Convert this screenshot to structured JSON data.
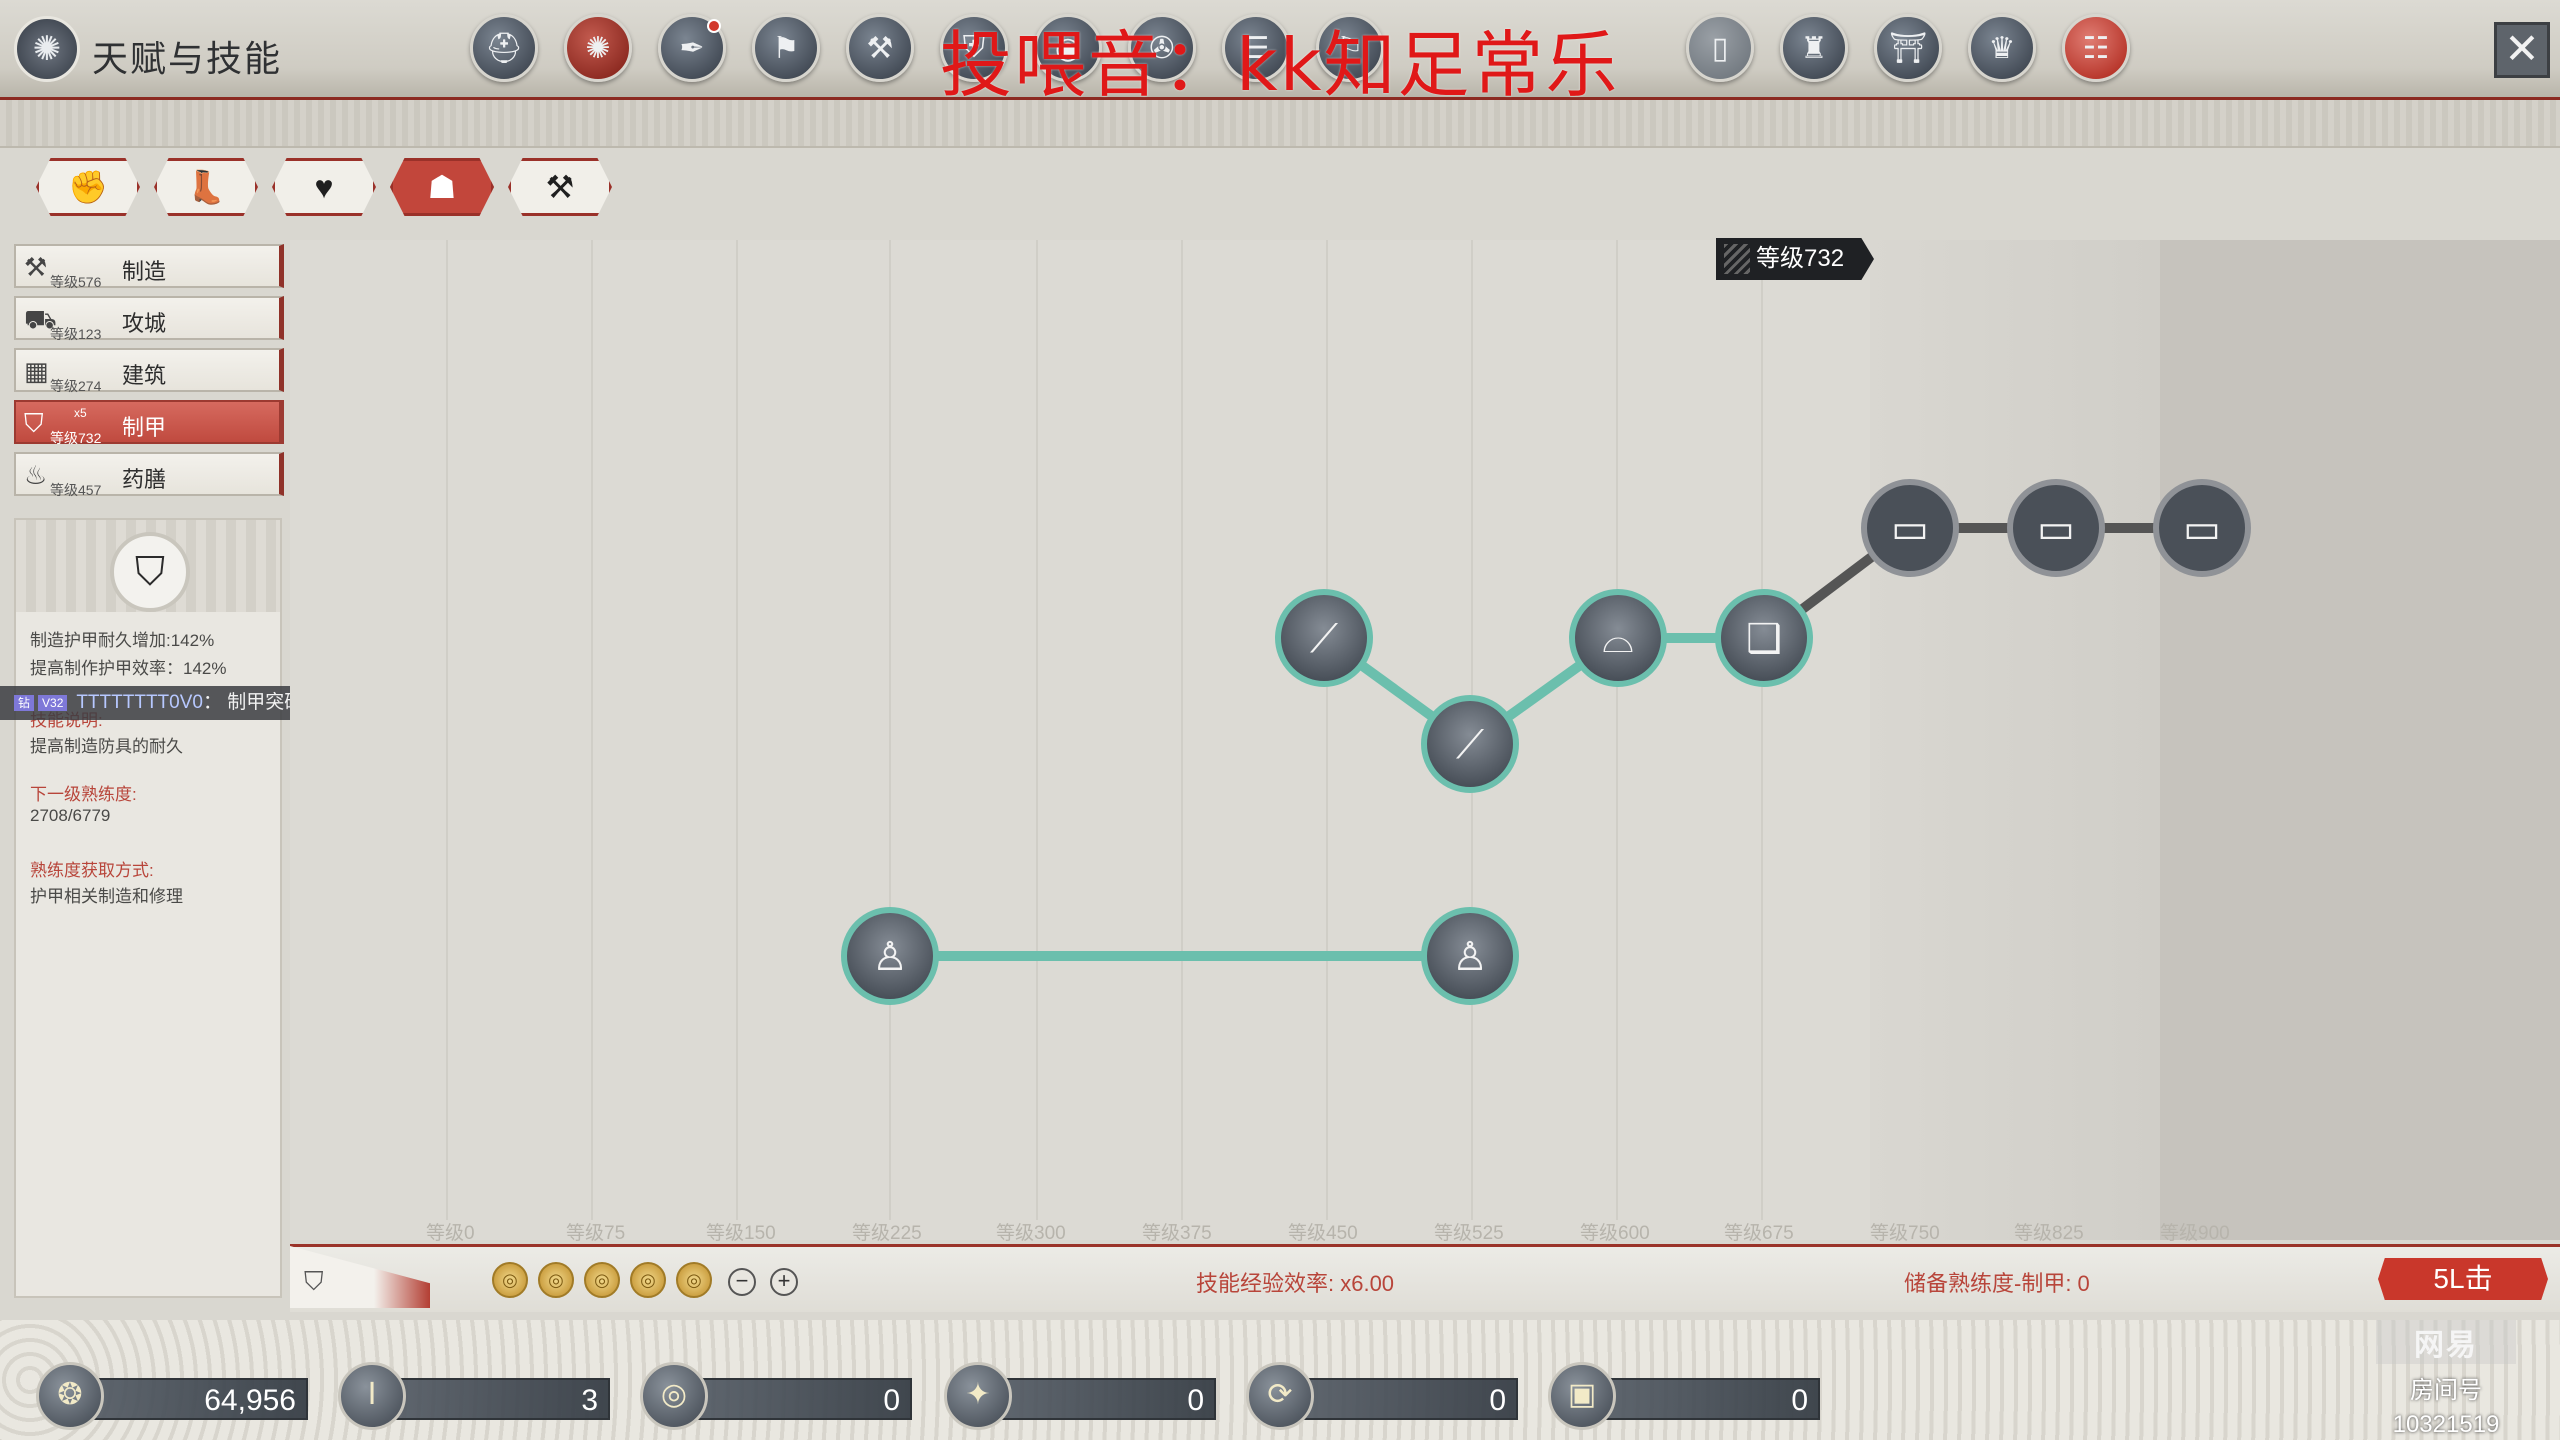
{
  "header": {
    "title": "天赋与技能",
    "overlay_text": "投喂音：kk知足常乐",
    "close_symbol": "✕",
    "nav_icons": [
      {
        "icon": "helmet-icon",
        "glyph": "⛑",
        "style": "normal"
      },
      {
        "icon": "skill-tree-icon",
        "glyph": "✺",
        "style": "active"
      },
      {
        "icon": "feather-scroll-icon",
        "glyph": "✒",
        "style": "normal",
        "badge": true
      },
      {
        "icon": "banner-icon",
        "glyph": "⚑",
        "style": "normal"
      },
      {
        "icon": "tools-icon",
        "glyph": "⚒",
        "style": "normal"
      },
      {
        "icon": "shield-icon",
        "glyph": "⛨",
        "style": "normal"
      },
      {
        "icon": "orb-icon",
        "glyph": "◉",
        "style": "normal"
      },
      {
        "icon": "compass-icon",
        "glyph": "✇",
        "style": "normal"
      },
      {
        "icon": "scroll-icon",
        "glyph": "☰",
        "style": "normal"
      },
      {
        "icon": "map-icon",
        "glyph": "⚐",
        "style": "normal"
      },
      {
        "icon": "door-icon",
        "glyph": "▯",
        "style": "grey"
      },
      {
        "icon": "ranking-icon",
        "glyph": "♜",
        "style": "normal"
      },
      {
        "icon": "pavilion-icon",
        "glyph": "⛩",
        "style": "normal"
      },
      {
        "icon": "guild-icon",
        "glyph": "♛",
        "style": "normal"
      },
      {
        "icon": "book-icon",
        "glyph": "☷",
        "style": "red-book"
      }
    ]
  },
  "category_tabs": [
    {
      "icon": "fist-icon",
      "glyph": "✊"
    },
    {
      "icon": "boot-icon",
      "glyph": "👢"
    },
    {
      "icon": "heart-icon",
      "glyph": "♥"
    },
    {
      "icon": "crafter-icon",
      "glyph": "☗",
      "active": true
    },
    {
      "icon": "hammer-tag-icon",
      "glyph": "⚒"
    }
  ],
  "skills": [
    {
      "name": "制造",
      "level": "等级576",
      "glyph": "⚒",
      "icon": "hammer-icon"
    },
    {
      "name": "攻城",
      "level": "等级123",
      "glyph": "⛟",
      "icon": "catapult-icon"
    },
    {
      "name": "建筑",
      "level": "等级274",
      "glyph": "▦",
      "icon": "building-icon"
    },
    {
      "name": "制甲",
      "level": "等级732",
      "glyph": "⛉",
      "icon": "armor-shield-icon",
      "active": true,
      "extra": "x5"
    },
    {
      "name": "药膳",
      "level": "等级457",
      "glyph": "♨",
      "icon": "bowl-icon"
    }
  ],
  "info": {
    "line1": "制造护甲耐久增加:142%",
    "line2": "提高制作护甲效率：142%",
    "desc_title": "技能说明:",
    "desc": "提高制造防具的耐久",
    "next_title": "下一级熟练度:",
    "next_value": "2708/6779",
    "gain_title": "熟练度获取方式:",
    "gain_value": "护甲相关制造和修理"
  },
  "chat": {
    "tag1": "钻",
    "tag2": "V32",
    "user": "TTTTTTTT0V0",
    "sep": "：",
    "message": "制甲突破了吗?"
  },
  "tree": {
    "level_flag": "等级732",
    "axis_labels": [
      "等级0",
      "等级75",
      "等级150",
      "等级225",
      "等级300",
      "等级375",
      "等级450",
      "等级525",
      "等级600",
      "等级675",
      "等级750",
      "等级825",
      "等级900"
    ],
    "nodes": [
      {
        "id": "blade1",
        "icon": "sword-icon",
        "glyph": "⟋",
        "unlocked": true
      },
      {
        "id": "blade2",
        "icon": "sword-icon",
        "glyph": "⟋",
        "unlocked": true
      },
      {
        "id": "basket",
        "icon": "basket-icon",
        "glyph": "⌓",
        "unlocked": true
      },
      {
        "id": "book",
        "icon": "open-book-icon",
        "glyph": "❑",
        "unlocked": true
      },
      {
        "id": "chest1",
        "icon": "chest-icon",
        "glyph": "▭",
        "unlocked": false
      },
      {
        "id": "chest2",
        "icon": "chest-icon",
        "glyph": "▭",
        "unlocked": false
      },
      {
        "id": "chest3",
        "icon": "chest-icon",
        "glyph": "▭",
        "unlocked": false
      },
      {
        "id": "armor1",
        "icon": "armor-icon",
        "glyph": "♙",
        "unlocked": true
      },
      {
        "id": "armor2",
        "icon": "armor-icon",
        "glyph": "♙",
        "unlocked": true
      }
    ]
  },
  "status": {
    "exp_rate": "技能经验效率: x6.00",
    "reserve": "储备熟练度-制甲: 0",
    "stamp": "5L击",
    "coin_glyph": "◎",
    "minus": "−",
    "plus": "+"
  },
  "resources": [
    {
      "icon": "silver-coin-icon",
      "glyph": "❂",
      "value": "64,956"
    },
    {
      "icon": "pillar-icon",
      "glyph": "Ⅰ",
      "value": "3"
    },
    {
      "icon": "spiral-coin-icon",
      "glyph": "◎",
      "value": "0"
    },
    {
      "icon": "constellation-icon",
      "glyph": "✦",
      "value": "0"
    },
    {
      "icon": "refresh-icon",
      "glyph": "⟳",
      "value": "0"
    },
    {
      "icon": "chest-token-icon",
      "glyph": "▣",
      "value": "0"
    }
  ],
  "watermark": {
    "brand": "网易",
    "tag": "房间号",
    "room_id": "10321519"
  }
}
